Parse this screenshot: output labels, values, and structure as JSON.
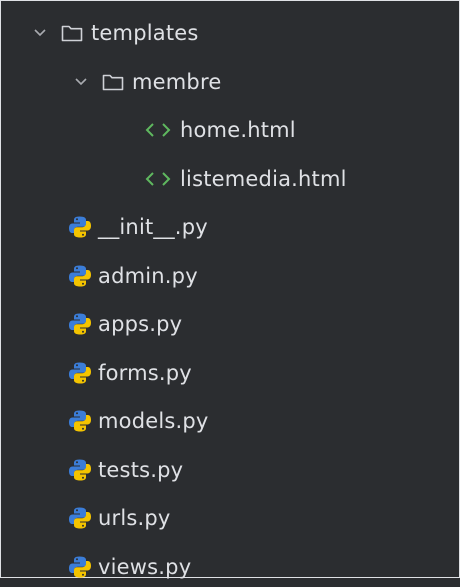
{
  "tree": {
    "rows": [
      {
        "label": "templates",
        "icon": "folder-icon",
        "expanded": true
      },
      {
        "label": "membre",
        "icon": "folder-icon",
        "expanded": true
      },
      {
        "label": "home.html",
        "icon": "html-file-icon"
      },
      {
        "label": "listemedia.html",
        "icon": "html-file-icon"
      },
      {
        "label": "__init__.py",
        "icon": "python-file-icon"
      },
      {
        "label": "admin.py",
        "icon": "python-file-icon"
      },
      {
        "label": "apps.py",
        "icon": "python-file-icon"
      },
      {
        "label": "forms.py",
        "icon": "python-file-icon"
      },
      {
        "label": "models.py",
        "icon": "python-file-icon"
      },
      {
        "label": "tests.py",
        "icon": "python-file-icon"
      },
      {
        "label": "urls.py",
        "icon": "python-file-icon"
      },
      {
        "label": "views.py",
        "icon": "python-file-icon"
      }
    ]
  },
  "colors": {
    "background": "#2b2d30",
    "text": "#dfe1e5",
    "html_icon": "#5fb85f",
    "python_blue": "#3b7dd8",
    "python_yellow": "#f4c400"
  }
}
